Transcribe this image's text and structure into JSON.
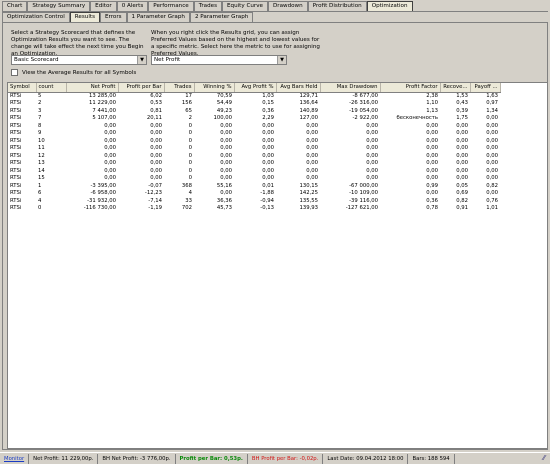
{
  "top_tabs": [
    "Chart",
    "Strategy Summary",
    "Editor",
    "0 Alerts",
    "Performance",
    "Trades",
    "Equity Curve",
    "Drawdown",
    "Profit Distribution",
    "Optimization"
  ],
  "active_top_tab": 9,
  "sub_tabs": [
    "Optimization Control",
    "Results",
    "Errors",
    "1 Parameter Graph",
    "2 Parameter Graph"
  ],
  "active_sub_tab": 1,
  "desc_left": "Select a Strategy Scorecard that defines the Optimization Results you want to see.  The change will take effect the next time you Begin an Optimization.",
  "desc_right": "When you right click the Results grid, you can assign Preferred Values based on the highest and lowest values for a specific metric. Select here the metric to use for assigning Preferred Values.",
  "scorecard_value": "Basic Scorecard",
  "metric_value": "Net Profit",
  "avg_checkbox_label": "View the Average Results for all Symbols",
  "columns": [
    "Symbol",
    "count",
    "Net Profit",
    "Profit per Bar",
    "Trades",
    "Winning %",
    "Avg Profit %",
    "Avg Bars Held",
    "Max Drawdown",
    "Profit Factor",
    "Recove...",
    "Payoff ..."
  ],
  "rows": [
    [
      "RTSi",
      "5",
      "13 285,00",
      "6,02",
      "17",
      "70,59",
      "1,03",
      "129,71",
      "-8 677,00",
      "2,38",
      "1,53",
      "1,63"
    ],
    [
      "RTSi",
      "2",
      "11 229,00",
      "0,53",
      "156",
      "54,49",
      "0,15",
      "136,64",
      "-26 316,00",
      "1,10",
      "0,43",
      "0,97"
    ],
    [
      "RTSi",
      "3",
      "7 441,00",
      "0,81",
      "65",
      "49,23",
      "0,36",
      "140,89",
      "-19 054,00",
      "1,13",
      "0,39",
      "1,34"
    ],
    [
      "RTSi",
      "7",
      "5 107,00",
      "20,11",
      "2",
      "100,00",
      "2,29",
      "127,00",
      "-2 922,00",
      "бесконечность",
      "1,75",
      "0,00"
    ],
    [
      "RTSi",
      "8",
      "0,00",
      "0,00",
      "0",
      "0,00",
      "0,00",
      "0,00",
      "0,00",
      "0,00",
      "0,00",
      "0,00"
    ],
    [
      "RTSi",
      "9",
      "0,00",
      "0,00",
      "0",
      "0,00",
      "0,00",
      "0,00",
      "0,00",
      "0,00",
      "0,00",
      "0,00"
    ],
    [
      "RTSi",
      "10",
      "0,00",
      "0,00",
      "0",
      "0,00",
      "0,00",
      "0,00",
      "0,00",
      "0,00",
      "0,00",
      "0,00"
    ],
    [
      "RTSi",
      "11",
      "0,00",
      "0,00",
      "0",
      "0,00",
      "0,00",
      "0,00",
      "0,00",
      "0,00",
      "0,00",
      "0,00"
    ],
    [
      "RTSi",
      "12",
      "0,00",
      "0,00",
      "0",
      "0,00",
      "0,00",
      "0,00",
      "0,00",
      "0,00",
      "0,00",
      "0,00"
    ],
    [
      "RTSi",
      "13",
      "0,00",
      "0,00",
      "0",
      "0,00",
      "0,00",
      "0,00",
      "0,00",
      "0,00",
      "0,00",
      "0,00"
    ],
    [
      "RTSi",
      "14",
      "0,00",
      "0,00",
      "0",
      "0,00",
      "0,00",
      "0,00",
      "0,00",
      "0,00",
      "0,00",
      "0,00"
    ],
    [
      "RTSi",
      "15",
      "0,00",
      "0,00",
      "0",
      "0,00",
      "0,00",
      "0,00",
      "0,00",
      "0,00",
      "0,00",
      "0,00"
    ],
    [
      "RTSi",
      "1",
      "-3 395,00",
      "-0,07",
      "368",
      "55,16",
      "0,01",
      "130,15",
      "-67 000,00",
      "0,99",
      "0,05",
      "0,82"
    ],
    [
      "RTSi",
      "6",
      "-6 958,00",
      "-12,23",
      "4",
      "0,00",
      "-1,88",
      "142,25",
      "-10 109,00",
      "0,00",
      "0,69",
      "0,00"
    ],
    [
      "RTSi",
      "4",
      "-31 932,00",
      "-7,14",
      "33",
      "36,36",
      "-0,94",
      "135,55",
      "-39 116,00",
      "0,36",
      "0,82",
      "0,76"
    ],
    [
      "RTSi",
      "0",
      "-116 730,00",
      "-1,19",
      "702",
      "45,73",
      "-0,13",
      "139,93",
      "-127 621,00",
      "0,78",
      "0,91",
      "1,01"
    ]
  ],
  "status": {
    "monitor": "Monitor",
    "net_profit": "Net Profit: 11 229,00p.",
    "bh_net_profit": "BH Net Profit: -3 776,00p.",
    "profit_per_bar": "Profit per Bar: 0,53p.",
    "bh_profit_per_bar": "BH Profit per Bar: -0,02p.",
    "last_date": "Last Date: 09.04.2012 18:00",
    "bars": "Bars: 188 594"
  }
}
